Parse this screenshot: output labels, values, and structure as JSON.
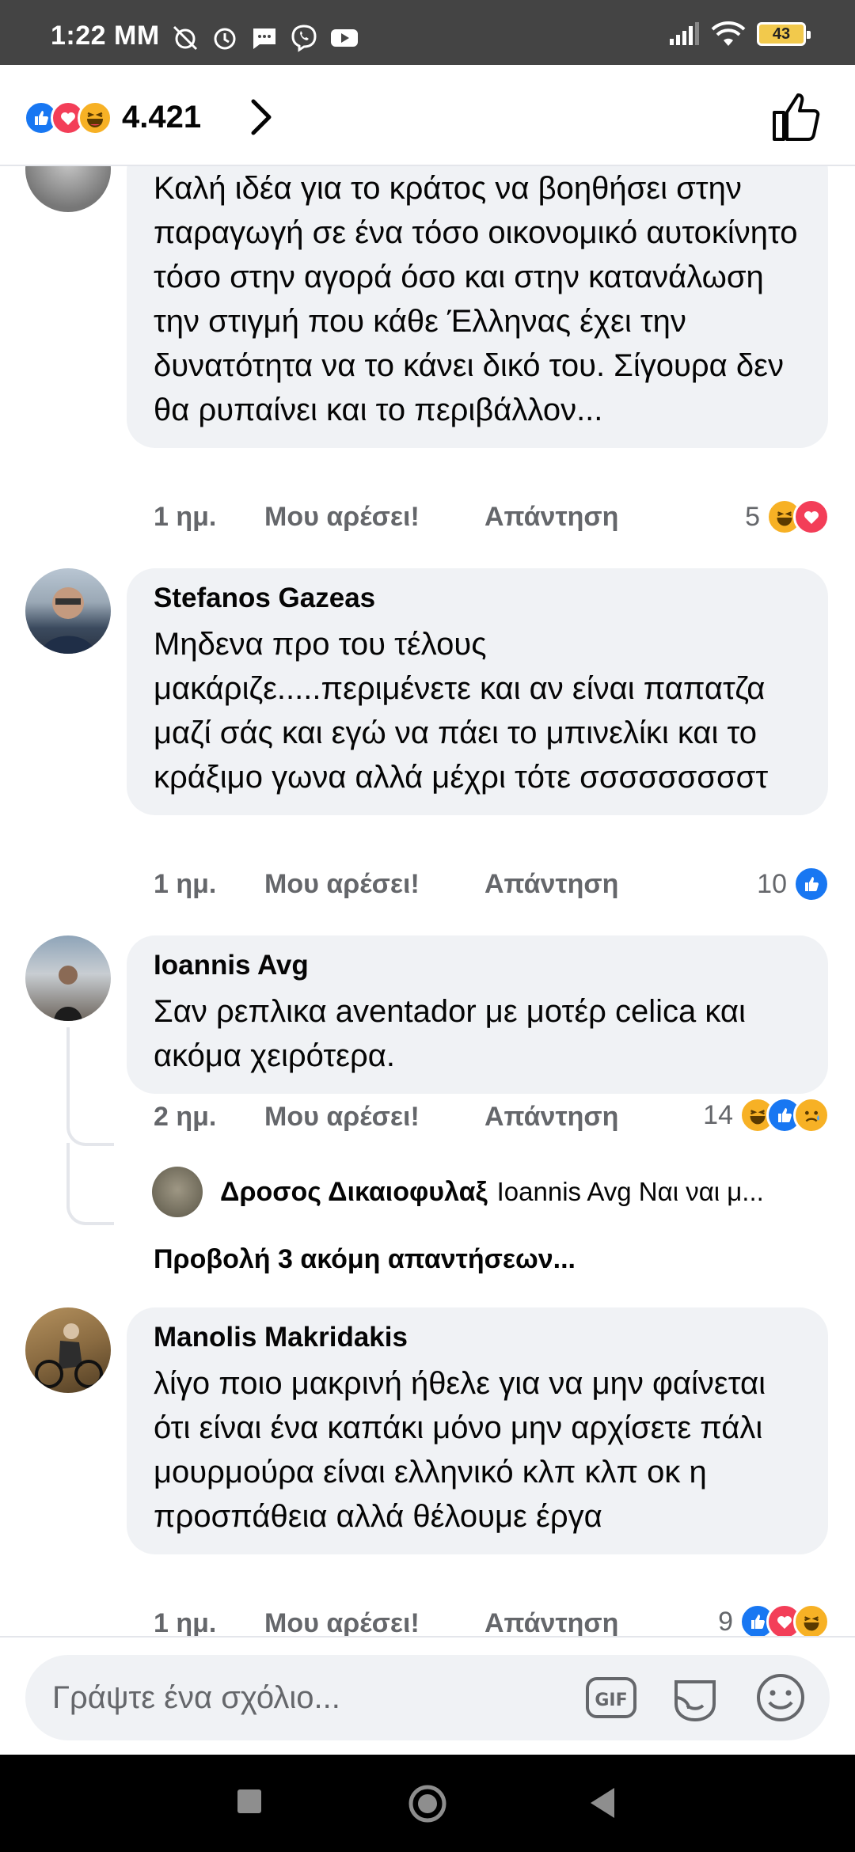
{
  "status_bar": {
    "time": "1:22 ΜΜ",
    "battery": "43"
  },
  "header": {
    "reaction_count": "4.421"
  },
  "comments": [
    {
      "author": "",
      "text": "Καλή ιδέα για το κράτος να βοηθήσει στην παραγωγή σε ένα τόσο οικονομικό αυτοκίνητο τόσο στην αγορά όσο και στην κατανάλωση την στιγμή που κάθε Έλληνας έχει την δυνατότητα να το κάνει δικό του. Σίγουρα δεν θα ρυπαίνει και το περιβάλλον...",
      "time": "1 ημ.",
      "like": "Μου αρέσει!",
      "reply": "Απάντηση",
      "reactions": "5"
    },
    {
      "author": "Stefanos Gazeas",
      "text": "Μηδενα προ του τέλους μακάριζε.....περιμένετε και αν είναι παπατζα μαζί σάς και εγώ να πάει το μπινελίκι και το κράξιμο γωνα αλλά μέχρι τότε σσσσσσσσστ",
      "time": "1 ημ.",
      "like": "Μου αρέσει!",
      "reply": "Απάντηση",
      "reactions": "10"
    },
    {
      "author": "Ioannis Avg",
      "text": "Σαν ρεπλικα aventador με μοτέρ celica και ακόμα χειρότερα.",
      "time": "2 ημ.",
      "like": "Μου αρέσει!",
      "reply": "Απάντηση",
      "reactions": "14",
      "reply_preview": {
        "author": "Δροσος Δικαιοφυλαξ",
        "text": "Ioannis Avg Ναι ναι μ..."
      },
      "more_replies": "Προβολή 3 ακόμη απαντήσεων..."
    },
    {
      "author": "Manolis Makridakis",
      "text": "λίγο ποιο μακρινή ήθελε για να μην φαίνεται ότι είναι ένα καπάκι μόνο μην αρχίσετε πάλι μουρμούρα είναι ελληνικό κλπ κλπ οκ η προσπάθεια αλλά θέλουμε έργα",
      "time": "1 ημ.",
      "like": "Μου αρέσει!",
      "reply": "Απάντηση",
      "reactions": "9"
    }
  ],
  "composer": {
    "placeholder": "Γράψτε ένα σχόλιο..."
  },
  "colors": {
    "accent": "#1877f2",
    "love": "#f33e58",
    "haha": "#f7b125",
    "bubble": "#f0f2f5",
    "meta": "#65676b"
  }
}
